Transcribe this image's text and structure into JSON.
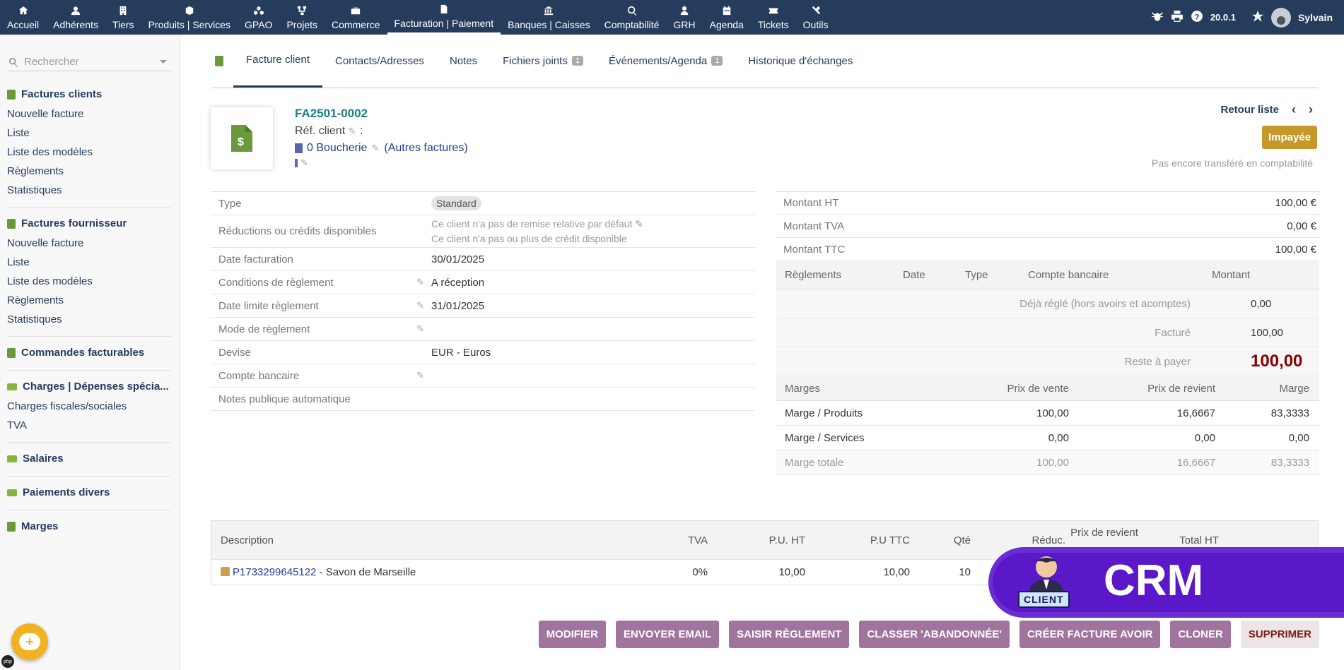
{
  "topnav": {
    "items": [
      {
        "label": "Accueil",
        "icon": "home-icon"
      },
      {
        "label": "Adhérents",
        "icon": "user-icon"
      },
      {
        "label": "Tiers",
        "icon": "building-icon"
      },
      {
        "label": "Produits | Services",
        "icon": "cube-icon"
      },
      {
        "label": "GPAO",
        "icon": "cubes-icon"
      },
      {
        "label": "Projets",
        "icon": "project-icon"
      },
      {
        "label": "Commerce",
        "icon": "briefcase-icon"
      },
      {
        "label": "Facturation | Paiement",
        "icon": "invoice-icon"
      },
      {
        "label": "Banques | Caisses",
        "icon": "bank-icon"
      },
      {
        "label": "Comptabilité",
        "icon": "search-dollar-icon"
      },
      {
        "label": "GRH",
        "icon": "user-tie-icon"
      },
      {
        "label": "Agenda",
        "icon": "calendar-icon"
      },
      {
        "label": "Tickets",
        "icon": "ticket-icon"
      },
      {
        "label": "Outils",
        "icon": "tools-icon"
      }
    ],
    "version": "20.0.1",
    "username": "Sylvain"
  },
  "sidebar": {
    "search_placeholder": "Rechercher",
    "blocks": [
      {
        "title": "Factures clients",
        "links": [
          "Nouvelle facture",
          "Liste",
          "Liste des modèles",
          "Règlements",
          "Statistiques"
        ]
      },
      {
        "title": "Factures fournisseur",
        "links": [
          "Nouvelle facture",
          "Liste",
          "Liste des modèles",
          "Règlements",
          "Statistiques"
        ]
      },
      {
        "title": "Commandes facturables",
        "links": []
      },
      {
        "title": "Charges | Dépenses spécia...",
        "links": [
          "Charges fiscales/sociales",
          "TVA"
        ]
      },
      {
        "title": "Salaires",
        "links": []
      },
      {
        "title": "Paiements divers",
        "links": []
      },
      {
        "title": "Marges",
        "links": []
      }
    ]
  },
  "tabs": [
    {
      "label": "Facture client"
    },
    {
      "label": "Contacts/Adresses"
    },
    {
      "label": "Notes"
    },
    {
      "label": "Fichiers joints",
      "badge": "1"
    },
    {
      "label": "Événements/Agenda",
      "badge": "1"
    },
    {
      "label": "Historique d'échanges"
    }
  ],
  "invoice": {
    "ref": "FA2501-0002",
    "ref_client_label": "Réf. client",
    "ref_client_sep": ":",
    "tiers": "0 Boucherie",
    "other_invoices": "(Autres factures)",
    "back_list": "Retour liste",
    "status": "Impayée",
    "accounting": "Pas encore transféré en comptabilité"
  },
  "info": {
    "type_label": "Type",
    "type_value": "Standard",
    "reductions_label": "Réductions ou crédits disponibles",
    "reductions_line1": "Ce client n'a pas de remise relative par défaut",
    "reductions_line2": "Ce client n'a pas ou plus de crédit disponible",
    "date_label": "Date facturation",
    "date_value": "30/01/2025",
    "cond_label": "Conditions de règlement",
    "cond_value": "A réception",
    "limit_label": "Date limite règlement",
    "limit_value": "31/01/2025",
    "mode_label": "Mode de règlement",
    "devise_label": "Devise",
    "devise_value": "EUR - Euros",
    "bank_label": "Compte bancaire",
    "notes_label": "Notes publique automatique"
  },
  "amounts": {
    "ht_label": "Montant HT",
    "ht_value": "100,00 €",
    "tva_label": "Montant TVA",
    "tva_value": "0,00 €",
    "ttc_label": "Montant TTC",
    "ttc_value": "100,00 €"
  },
  "payments": {
    "headers": [
      "Règlements",
      "Date",
      "Type",
      "Compte bancaire",
      "Montant"
    ],
    "already_label": "Déjà réglé (hors avoirs et acomptes)",
    "already_value": "0,00",
    "billed_label": "Facturé",
    "billed_value": "100,00",
    "remain_label": "Reste à payer",
    "remain_value": "100,00"
  },
  "margins": {
    "headers": [
      "Marges",
      "Prix de vente",
      "Prix de revient",
      "Marge"
    ],
    "rows": [
      [
        "Marge / Produits",
        "100,00",
        "16,6667",
        "83,3333"
      ],
      [
        "Marge / Services",
        "0,00",
        "0,00",
        "0,00"
      ],
      [
        "Marge totale",
        "100,00",
        "16,6667",
        "83,3333"
      ]
    ]
  },
  "lines": {
    "headers": [
      "Description",
      "TVA",
      "P.U. HT",
      "P.U TTC",
      "Qté",
      "Réduc.",
      "Prix de revient",
      "Total HT"
    ],
    "rows": [
      {
        "ref": "P1733299645122",
        "label": " - Savon de Marseille",
        "tva": "0%",
        "puht": "10,00",
        "puttc": "10,00",
        "qte": "10"
      }
    ]
  },
  "actions": [
    "Modifier",
    "Envoyer email",
    "Saisir règlement",
    "Classer 'abandonnée'",
    "Créer facture avoir",
    "Cloner",
    "Supprimer"
  ],
  "crm": {
    "label": "CLIENT",
    "text": "CRM"
  },
  "php_badge": "php"
}
